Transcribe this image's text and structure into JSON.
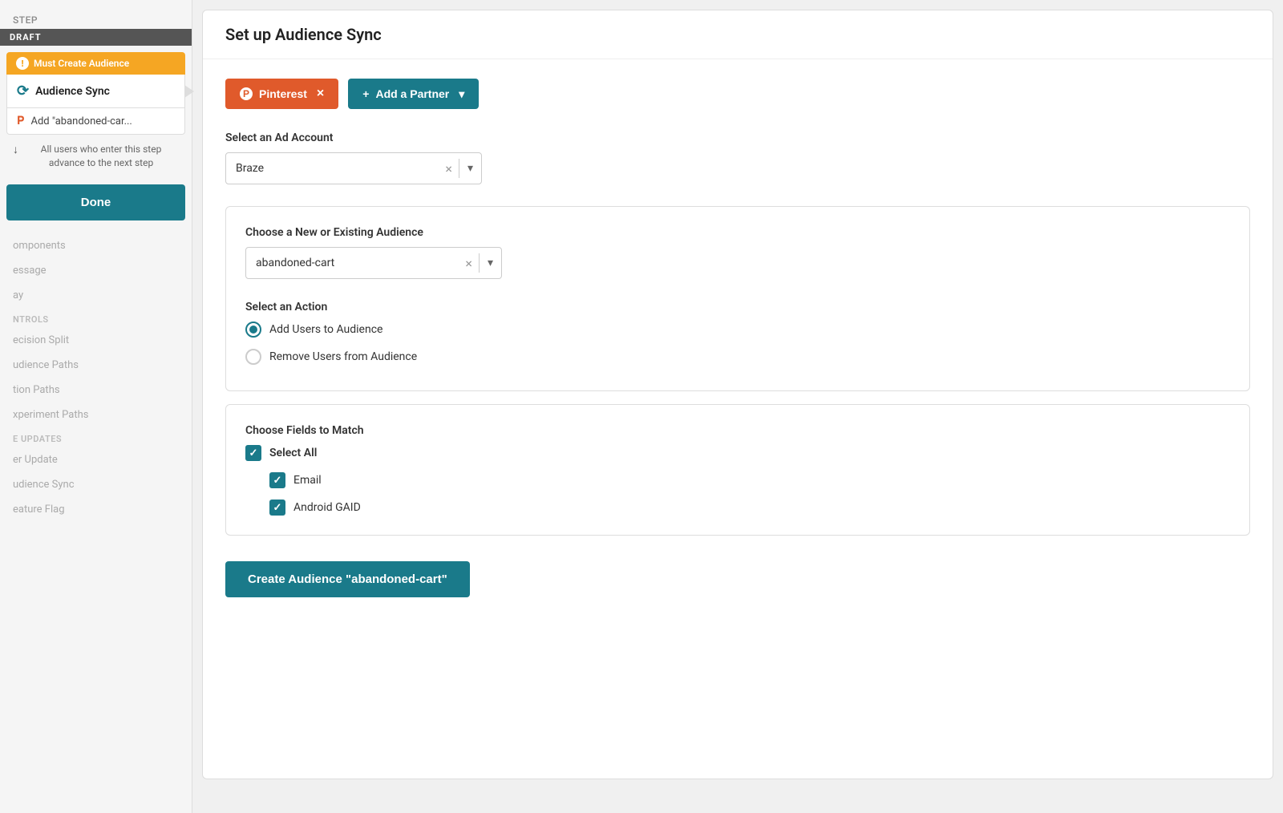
{
  "sidebar": {
    "step_label": "Step",
    "draft_badge": "DRAFT",
    "must_create_label": "Must Create Audience",
    "audience_sync_label": "Audience Sync",
    "add_item_label": "Add \"abandoned-car...",
    "advance_text": "All users who enter this step advance to the next step",
    "done_button": "Done",
    "nav_items": [
      {
        "label": "omponents",
        "indent": false
      },
      {
        "label": "essage",
        "indent": false
      },
      {
        "label": "ay",
        "indent": false
      },
      {
        "label": "ntrols",
        "indent": false,
        "is_header": true
      },
      {
        "label": "ecision Split",
        "indent": false
      },
      {
        "label": "udience Paths",
        "indent": false
      },
      {
        "label": "tion Paths",
        "indent": false
      },
      {
        "label": "xperiment Paths",
        "indent": false
      },
      {
        "label": "e Updates",
        "indent": false,
        "is_header": true
      },
      {
        "label": "er Update",
        "indent": false
      },
      {
        "label": "udience Sync",
        "indent": false
      },
      {
        "label": "eature Flag",
        "indent": false
      }
    ]
  },
  "main": {
    "panel_title": "Set up Audience Sync",
    "partners": {
      "pinterest_label": "Pinterest",
      "pinterest_close": "×",
      "add_partner_label": "Add a Partner"
    },
    "ad_account": {
      "section_label": "Select an Ad Account",
      "selected_value": "Braze"
    },
    "audience": {
      "section_label": "Choose a New or Existing Audience",
      "selected_value": "abandoned-cart"
    },
    "action": {
      "section_label": "Select an Action",
      "option_add": "Add Users to Audience",
      "option_remove": "Remove Users from Audience"
    },
    "fields": {
      "section_label": "Choose Fields to Match",
      "select_all_label": "Select All",
      "email_label": "Email",
      "android_label": "Android GAID"
    },
    "create_button": "Create Audience \"abandoned-cart\""
  }
}
